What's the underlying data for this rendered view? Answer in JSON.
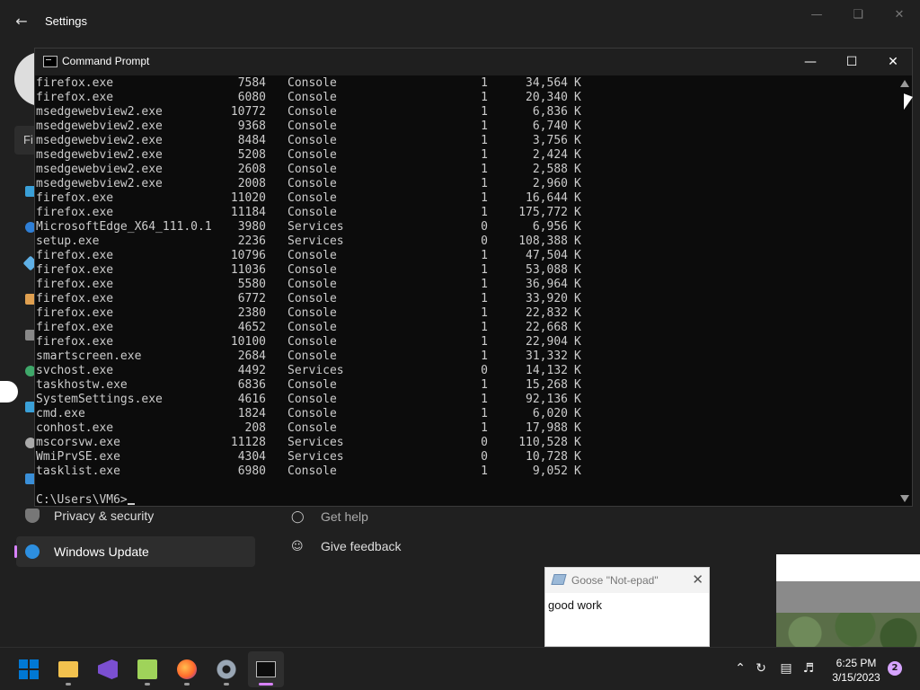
{
  "settings": {
    "title": "Settings",
    "search_peek": "Fi",
    "nav": [
      {
        "label": "Privacy & security",
        "icon": "shield-icon",
        "active": false
      },
      {
        "label": "Windows Update",
        "icon": "windows-update-icon",
        "active": true
      }
    ],
    "help_links": [
      {
        "label": "Get help",
        "icon": "help-icon"
      },
      {
        "label": "Give feedback",
        "icon": "feedback-icon"
      }
    ]
  },
  "cmd": {
    "title": "Command Prompt",
    "rows": [
      {
        "name": "firefox.exe",
        "pid": "7584",
        "session": "Console",
        "num": "1",
        "mem": "34,564",
        "unit": "K"
      },
      {
        "name": "firefox.exe",
        "pid": "6080",
        "session": "Console",
        "num": "1",
        "mem": "20,340",
        "unit": "K"
      },
      {
        "name": "msedgewebview2.exe",
        "pid": "10772",
        "session": "Console",
        "num": "1",
        "mem": "6,836",
        "unit": "K"
      },
      {
        "name": "msedgewebview2.exe",
        "pid": "9368",
        "session": "Console",
        "num": "1",
        "mem": "6,740",
        "unit": "K"
      },
      {
        "name": "msedgewebview2.exe",
        "pid": "8484",
        "session": "Console",
        "num": "1",
        "mem": "3,756",
        "unit": "K"
      },
      {
        "name": "msedgewebview2.exe",
        "pid": "5208",
        "session": "Console",
        "num": "1",
        "mem": "2,424",
        "unit": "K"
      },
      {
        "name": "msedgewebview2.exe",
        "pid": "2608",
        "session": "Console",
        "num": "1",
        "mem": "2,588",
        "unit": "K"
      },
      {
        "name": "msedgewebview2.exe",
        "pid": "2008",
        "session": "Console",
        "num": "1",
        "mem": "2,960",
        "unit": "K"
      },
      {
        "name": "firefox.exe",
        "pid": "11020",
        "session": "Console",
        "num": "1",
        "mem": "16,644",
        "unit": "K"
      },
      {
        "name": "firefox.exe",
        "pid": "11184",
        "session": "Console",
        "num": "1",
        "mem": "175,772",
        "unit": "K"
      },
      {
        "name": "MicrosoftEdge_X64_111.0.1",
        "pid": "3980",
        "session": "Services",
        "num": "0",
        "mem": "6,956",
        "unit": "K"
      },
      {
        "name": "setup.exe",
        "pid": "2236",
        "session": "Services",
        "num": "0",
        "mem": "108,388",
        "unit": "K"
      },
      {
        "name": "firefox.exe",
        "pid": "10796",
        "session": "Console",
        "num": "1",
        "mem": "47,504",
        "unit": "K"
      },
      {
        "name": "firefox.exe",
        "pid": "11036",
        "session": "Console",
        "num": "1",
        "mem": "53,088",
        "unit": "K"
      },
      {
        "name": "firefox.exe",
        "pid": "5580",
        "session": "Console",
        "num": "1",
        "mem": "36,964",
        "unit": "K"
      },
      {
        "name": "firefox.exe",
        "pid": "6772",
        "session": "Console",
        "num": "1",
        "mem": "33,920",
        "unit": "K"
      },
      {
        "name": "firefox.exe",
        "pid": "2380",
        "session": "Console",
        "num": "1",
        "mem": "22,832",
        "unit": "K"
      },
      {
        "name": "firefox.exe",
        "pid": "4652",
        "session": "Console",
        "num": "1",
        "mem": "22,668",
        "unit": "K"
      },
      {
        "name": "firefox.exe",
        "pid": "10100",
        "session": "Console",
        "num": "1",
        "mem": "22,904",
        "unit": "K"
      },
      {
        "name": "smartscreen.exe",
        "pid": "2684",
        "session": "Console",
        "num": "1",
        "mem": "31,332",
        "unit": "K"
      },
      {
        "name": "svchost.exe",
        "pid": "4492",
        "session": "Services",
        "num": "0",
        "mem": "14,132",
        "unit": "K"
      },
      {
        "name": "taskhostw.exe",
        "pid": "6836",
        "session": "Console",
        "num": "1",
        "mem": "15,268",
        "unit": "K"
      },
      {
        "name": "SystemSettings.exe",
        "pid": "4616",
        "session": "Console",
        "num": "1",
        "mem": "92,136",
        "unit": "K"
      },
      {
        "name": "cmd.exe",
        "pid": "1824",
        "session": "Console",
        "num": "1",
        "mem": "6,020",
        "unit": "K"
      },
      {
        "name": "conhost.exe",
        "pid": "208",
        "session": "Console",
        "num": "1",
        "mem": "17,988",
        "unit": "K"
      },
      {
        "name": "mscorsvw.exe",
        "pid": "11128",
        "session": "Services",
        "num": "0",
        "mem": "110,528",
        "unit": "K"
      },
      {
        "name": "WmiPrvSE.exe",
        "pid": "4304",
        "session": "Services",
        "num": "0",
        "mem": "10,728",
        "unit": "K"
      },
      {
        "name": "tasklist.exe",
        "pid": "6980",
        "session": "Console",
        "num": "1",
        "mem": "9,052",
        "unit": "K"
      }
    ],
    "prompt": "C:\\Users\\VM6>"
  },
  "goose": {
    "title": "Goose \"Not-epad\"",
    "text": "good work"
  },
  "taskbar": {
    "apps": [
      "start-icon",
      "file-explorer-icon",
      "visual-studio-icon",
      "notepad-plus-icon",
      "firefox-icon",
      "settings-gear-icon",
      "command-prompt-icon"
    ],
    "time": "6:25 PM",
    "date": "3/15/2023",
    "notifications": "2"
  },
  "colors": {
    "accent": "#d882ff",
    "console_bg": "#0c0c0c",
    "console_text": "#cccccc",
    "settings_bg": "#202020"
  }
}
